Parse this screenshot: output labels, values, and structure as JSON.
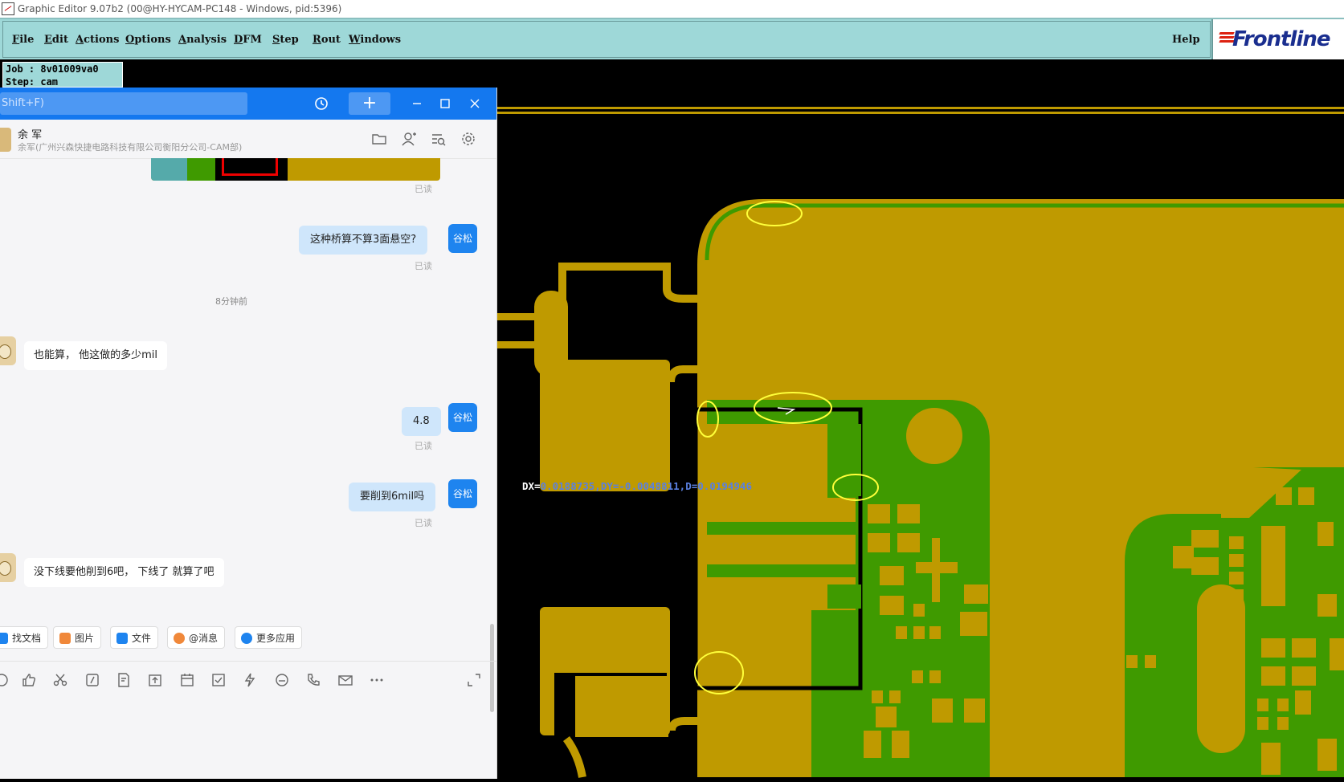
{
  "window": {
    "title": "Graphic Editor 9.07b2 (00@HY-HYCAM-PC148 - Windows, pid:5396)"
  },
  "menubar": {
    "items": [
      {
        "label": "File",
        "accel": "F",
        "rest": "ile"
      },
      {
        "label": "Edit",
        "accel": "E",
        "rest": "dit"
      },
      {
        "label": "Actions",
        "accel": "A",
        "rest": "ctions"
      },
      {
        "label": "Options",
        "accel": "O",
        "rest": "ptions"
      },
      {
        "label": "Analysis",
        "accel": "A",
        "rest": "nalysis"
      },
      {
        "label": "DFM",
        "accel": "D",
        "rest": "FM"
      },
      {
        "label": "Step",
        "accel": "S",
        "rest": "tep"
      },
      {
        "label": "Rout",
        "accel": "R",
        "rest": "out"
      },
      {
        "label": "Windows",
        "accel": "W",
        "rest": "indows"
      }
    ],
    "help": "Help",
    "logo": "Frontline"
  },
  "job": {
    "line1": "Job : 8v01009va0",
    "line2": "Step: cam"
  },
  "measure": {
    "prefix": "DX=",
    "value": "0.0188735,DY=-0.0048811,D=0.0194946"
  },
  "chat": {
    "search_placeholder": "Shift+F)",
    "header": {
      "name": "余 军",
      "org": "余军(广州兴森快捷电路科技有限公司衡阳分公司-CAM部)"
    },
    "read_label": "已读",
    "time_label": "8分钟前",
    "self_avatar": "谷松",
    "messages": [
      {
        "side": "right",
        "text": "这种桥算不算3面悬空?"
      },
      {
        "side": "left",
        "text": "也能算，   他这做的多少mil"
      },
      {
        "side": "right",
        "text": "4.8"
      },
      {
        "side": "right",
        "text": "要削到6mil吗"
      },
      {
        "side": "left",
        "text": "没下线要他削到6吧，  下线了 就算了吧"
      }
    ],
    "tools": [
      {
        "label": "找文档",
        "color": "#1e84ef",
        "icon": "doc-search-icon"
      },
      {
        "label": "图片",
        "color": "#f0883a",
        "icon": "image-icon"
      },
      {
        "label": "文件",
        "color": "#1e84ef",
        "icon": "folder-icon"
      },
      {
        "label": "@消息",
        "color": "#f0883a",
        "icon": "at-icon"
      },
      {
        "label": "更多应用",
        "color": "#1e84ef",
        "icon": "apps-icon"
      }
    ]
  },
  "colors": {
    "copper": "#bf9a00",
    "laminate": "#3f9a00",
    "highlight": "#ffff3a",
    "menubar_bg": "#9ed8d8",
    "chat_blue": "#1478ef"
  }
}
